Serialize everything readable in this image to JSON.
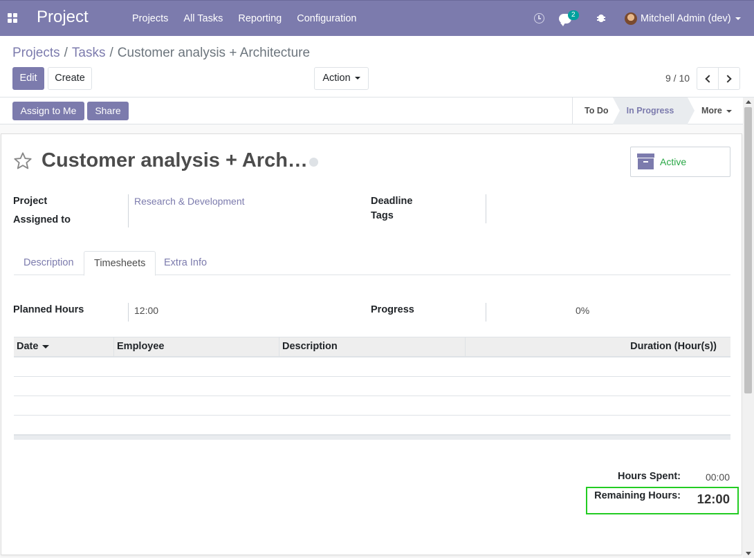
{
  "navbar": {
    "app_name": "Project",
    "menu": [
      "Projects",
      "All Tasks",
      "Reporting",
      "Configuration"
    ],
    "chat_count": "2",
    "user_name": "Mitchell Admin (dev)"
  },
  "breadcrumb": {
    "items": [
      "Projects",
      "Tasks"
    ],
    "current": "Customer analysis + Architecture"
  },
  "buttons": {
    "edit": "Edit",
    "create": "Create",
    "action": "Action",
    "assign_to_me": "Assign to Me",
    "share": "Share"
  },
  "pager": {
    "value": "9 / 10"
  },
  "stages": {
    "todo": "To Do",
    "current": "In Progress",
    "more": "More"
  },
  "task": {
    "title": "Customer analysis + Arch…",
    "active_label": "Active",
    "fields": {
      "project_label": "Project",
      "project_value": "Research & Development",
      "assigned_label": "Assigned to",
      "deadline_label": "Deadline",
      "tags_label": "Tags"
    }
  },
  "tabs": [
    "Description",
    "Timesheets",
    "Extra Info"
  ],
  "timesheets": {
    "planned_label": "Planned Hours",
    "planned_value": "12:00",
    "progress_label": "Progress",
    "progress_value": "0%",
    "columns": [
      "Date",
      "Employee",
      "Description",
      "Duration (Hour(s))"
    ],
    "hours_spent_label": "Hours Spent:",
    "hours_spent_value": "00:00",
    "remaining_label": "Remaining Hours:",
    "remaining_value": "12:00"
  },
  "colors": {
    "brand": "#7c7bad",
    "active_green": "#28a745",
    "highlight": "#22cc22"
  }
}
